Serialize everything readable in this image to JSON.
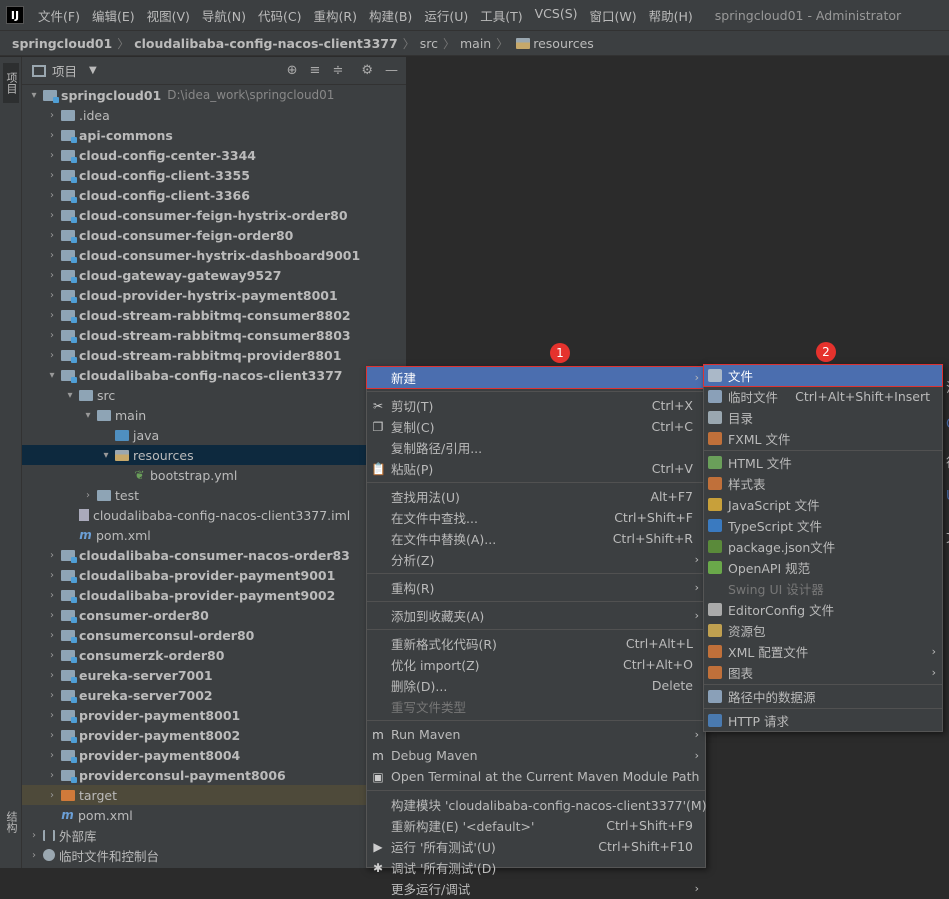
{
  "menubar": {
    "items": [
      "文件(F)",
      "编辑(E)",
      "视图(V)",
      "导航(N)",
      "代码(C)",
      "重构(R)",
      "构建(B)",
      "运行(U)",
      "工具(T)",
      "VCS(S)",
      "窗口(W)",
      "帮助(H)"
    ],
    "title": "springcloud01 - Administrator"
  },
  "breadcrumb": [
    "springcloud01",
    "cloudalibaba-config-nacos-client3377",
    "src",
    "main",
    "resources"
  ],
  "side_tabs": {
    "project": "项目",
    "structure": "结构"
  },
  "panel": {
    "title": "项目"
  },
  "tree": [
    {
      "label": "springcloud01",
      "path": "D:\\idea_work\\springcloud01",
      "depth": 0,
      "arrow": "▾",
      "icon": "folder-mod",
      "bold": true
    },
    {
      "label": ".idea",
      "depth": 1,
      "arrow": "›",
      "icon": "folder"
    },
    {
      "label": "api-commons",
      "depth": 1,
      "arrow": "›",
      "icon": "folder-mod",
      "bold": true
    },
    {
      "label": "cloud-config-center-3344",
      "depth": 1,
      "arrow": "›",
      "icon": "folder-mod",
      "bold": true
    },
    {
      "label": "cloud-config-client-3355",
      "depth": 1,
      "arrow": "›",
      "icon": "folder-mod",
      "bold": true
    },
    {
      "label": "cloud-config-client-3366",
      "depth": 1,
      "arrow": "›",
      "icon": "folder-mod",
      "bold": true
    },
    {
      "label": "cloud-consumer-feign-hystrix-order80",
      "depth": 1,
      "arrow": "›",
      "icon": "folder-mod",
      "bold": true
    },
    {
      "label": "cloud-consumer-feign-order80",
      "depth": 1,
      "arrow": "›",
      "icon": "folder-mod",
      "bold": true
    },
    {
      "label": "cloud-consumer-hystrix-dashboard9001",
      "depth": 1,
      "arrow": "›",
      "icon": "folder-mod",
      "bold": true
    },
    {
      "label": "cloud-gateway-gateway9527",
      "depth": 1,
      "arrow": "›",
      "icon": "folder-mod",
      "bold": true
    },
    {
      "label": "cloud-provider-hystrix-payment8001",
      "depth": 1,
      "arrow": "›",
      "icon": "folder-mod",
      "bold": true
    },
    {
      "label": "cloud-stream-rabbitmq-consumer8802",
      "depth": 1,
      "arrow": "›",
      "icon": "folder-mod",
      "bold": true
    },
    {
      "label": "cloud-stream-rabbitmq-consumer8803",
      "depth": 1,
      "arrow": "›",
      "icon": "folder-mod",
      "bold": true
    },
    {
      "label": "cloud-stream-rabbitmq-provider8801",
      "depth": 1,
      "arrow": "›",
      "icon": "folder-mod",
      "bold": true
    },
    {
      "label": "cloudalibaba-config-nacos-client3377",
      "depth": 1,
      "arrow": "▾",
      "icon": "folder-mod",
      "bold": true
    },
    {
      "label": "src",
      "depth": 2,
      "arrow": "▾",
      "icon": "folder"
    },
    {
      "label": "main",
      "depth": 3,
      "arrow": "▾",
      "icon": "folder"
    },
    {
      "label": "java",
      "depth": 4,
      "arrow": "",
      "icon": "folder-src"
    },
    {
      "label": "resources",
      "depth": 4,
      "arrow": "▾",
      "icon": "folder-res",
      "selected": true
    },
    {
      "label": "bootstrap.yml",
      "depth": 5,
      "arrow": "",
      "icon": "leaf"
    },
    {
      "label": "test",
      "depth": 3,
      "arrow": "›",
      "icon": "folder"
    },
    {
      "label": "cloudalibaba-config-nacos-client3377.iml",
      "depth": 2,
      "arrow": "",
      "icon": "iml"
    },
    {
      "label": "pom.xml",
      "depth": 2,
      "arrow": "",
      "icon": "maven"
    },
    {
      "label": "cloudalibaba-consumer-nacos-order83",
      "depth": 1,
      "arrow": "›",
      "icon": "folder-mod",
      "bold": true
    },
    {
      "label": "cloudalibaba-provider-payment9001",
      "depth": 1,
      "arrow": "›",
      "icon": "folder-mod",
      "bold": true
    },
    {
      "label": "cloudalibaba-provider-payment9002",
      "depth": 1,
      "arrow": "›",
      "icon": "folder-mod",
      "bold": true
    },
    {
      "label": "consumer-order80",
      "depth": 1,
      "arrow": "›",
      "icon": "folder-mod",
      "bold": true
    },
    {
      "label": "consumerconsul-order80",
      "depth": 1,
      "arrow": "›",
      "icon": "folder-mod",
      "bold": true
    },
    {
      "label": "consumerzk-order80",
      "depth": 1,
      "arrow": "›",
      "icon": "folder-mod",
      "bold": true
    },
    {
      "label": "eureka-server7001",
      "depth": 1,
      "arrow": "›",
      "icon": "folder-mod",
      "bold": true
    },
    {
      "label": "eureka-server7002",
      "depth": 1,
      "arrow": "›",
      "icon": "folder-mod",
      "bold": true
    },
    {
      "label": "provider-payment8001",
      "depth": 1,
      "arrow": "›",
      "icon": "folder-mod",
      "bold": true
    },
    {
      "label": "provider-payment8002",
      "depth": 1,
      "arrow": "›",
      "icon": "folder-mod",
      "bold": true
    },
    {
      "label": "provider-payment8004",
      "depth": 1,
      "arrow": "›",
      "icon": "folder-mod",
      "bold": true
    },
    {
      "label": "providerconsul-payment8006",
      "depth": 1,
      "arrow": "›",
      "icon": "folder-mod",
      "bold": true
    },
    {
      "label": "target",
      "depth": 1,
      "arrow": "›",
      "icon": "folder-orange",
      "target": true
    },
    {
      "label": "pom.xml",
      "depth": 1,
      "arrow": "",
      "icon": "maven"
    },
    {
      "label": "外部库",
      "depth": 0,
      "arrow": "›",
      "icon": "lib"
    },
    {
      "label": "临时文件和控制台",
      "depth": 0,
      "arrow": "›",
      "icon": "tmp"
    }
  ],
  "context_menu": [
    {
      "label": "新建",
      "submenu": true,
      "highlight": true
    },
    {
      "sep": true
    },
    {
      "label": "剪切(T)",
      "shortcut": "Ctrl+X",
      "icon": "✂"
    },
    {
      "label": "复制(C)",
      "shortcut": "Ctrl+C",
      "icon": "❐"
    },
    {
      "label": "复制路径/引用..."
    },
    {
      "label": "粘贴(P)",
      "shortcut": "Ctrl+V",
      "icon": "📋"
    },
    {
      "sep": true
    },
    {
      "label": "查找用法(U)",
      "shortcut": "Alt+F7"
    },
    {
      "label": "在文件中查找...",
      "shortcut": "Ctrl+Shift+F"
    },
    {
      "label": "在文件中替换(A)...",
      "shortcut": "Ctrl+Shift+R"
    },
    {
      "label": "分析(Z)",
      "submenu": true
    },
    {
      "sep": true
    },
    {
      "label": "重构(R)",
      "submenu": true
    },
    {
      "sep": true
    },
    {
      "label": "添加到收藏夹(A)",
      "submenu": true
    },
    {
      "sep": true
    },
    {
      "label": "重新格式化代码(R)",
      "shortcut": "Ctrl+Alt+L"
    },
    {
      "label": "优化 import(Z)",
      "shortcut": "Ctrl+Alt+O"
    },
    {
      "label": "删除(D)...",
      "shortcut": "Delete"
    },
    {
      "label": "重写文件类型",
      "disabled": true
    },
    {
      "sep": true
    },
    {
      "label": "Run Maven",
      "submenu": true,
      "icon": "m"
    },
    {
      "label": "Debug Maven",
      "submenu": true,
      "icon": "m"
    },
    {
      "label": "Open Terminal at the Current Maven Module Path",
      "icon": "▣"
    },
    {
      "sep": true
    },
    {
      "label": "构建模块 'cloudalibaba-config-nacos-client3377'(M)"
    },
    {
      "label": "重新构建(E) '<default>'",
      "shortcut": "Ctrl+Shift+F9"
    },
    {
      "label": "运行 '所有测试'(U)",
      "shortcut": "Ctrl+Shift+F10",
      "icon": "▶"
    },
    {
      "label": "调试 '所有测试'(D)",
      "icon": "✱"
    },
    {
      "label": "更多运行/调试",
      "submenu": true
    }
  ],
  "new_submenu": [
    {
      "label": "文件",
      "highlight": true,
      "color": "#aab8c8"
    },
    {
      "label": "临时文件",
      "shortcut": "Ctrl+Alt+Shift+Insert",
      "color": "#8aa0b8"
    },
    {
      "label": "目录",
      "color": "#9aa7b0"
    },
    {
      "label": "FXML 文件",
      "color": "#c0703a"
    },
    {
      "sep": true
    },
    {
      "label": "HTML 文件",
      "color": "#6a9f5a"
    },
    {
      "label": "样式表",
      "color": "#c0703a"
    },
    {
      "label": "JavaScript 文件",
      "color": "#c8a03a"
    },
    {
      "label": "TypeScript 文件",
      "color": "#3a7ac0"
    },
    {
      "label": "package.json文件",
      "color": "#5a8a3a"
    },
    {
      "label": "OpenAPI 规范",
      "color": "#6aa84a"
    },
    {
      "label": "Swing UI 设计器",
      "disabled": true,
      "color": "#3c3f41"
    },
    {
      "label": "EditorConfig 文件",
      "color": "#aaaaaa"
    },
    {
      "label": "资源包",
      "color": "#c0a050"
    },
    {
      "label": "XML 配置文件",
      "submenu": true,
      "color": "#c0703a"
    },
    {
      "label": "图表",
      "submenu": true,
      "color": "#c0703a"
    },
    {
      "sep": true
    },
    {
      "label": "路径中的数据源",
      "color": "#8aa0b8"
    },
    {
      "sep": true
    },
    {
      "label": "HTTP 请求",
      "color": "#4a7ab0"
    }
  ],
  "badges": {
    "one": "1",
    "two": "2"
  }
}
